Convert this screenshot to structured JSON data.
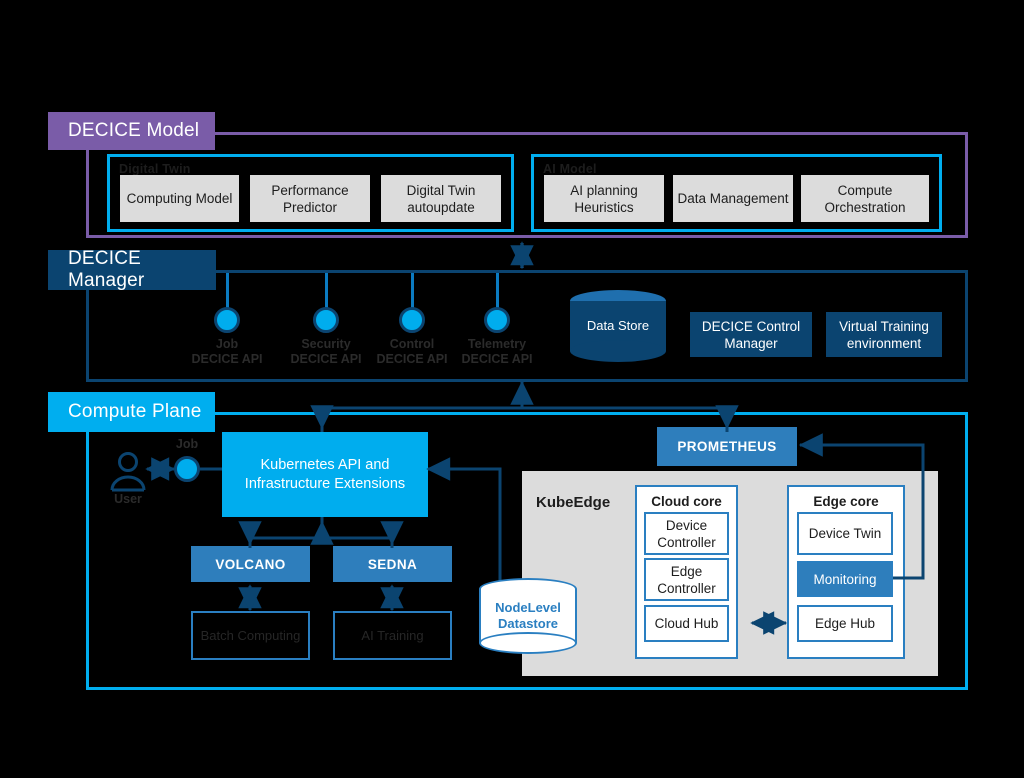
{
  "sections": {
    "model": {
      "title": "DECICE Model",
      "accent": "#7a5ca8",
      "groups": [
        {
          "title": "Digital Twin",
          "items": [
            "Computing Model",
            "Performance Predictor",
            "Digital Twin autoupdate"
          ]
        },
        {
          "title": "AI Model",
          "items": [
            "AI planning Heuristics",
            "Data Management",
            "Compute Orchestration"
          ]
        }
      ]
    },
    "manager": {
      "title": "DECICE Manager",
      "accent": "#0b4470",
      "apis": [
        {
          "name": "Job",
          "api": "DECICE API"
        },
        {
          "name": "Security",
          "api": "DECICE API"
        },
        {
          "name": "Control",
          "api": "DECICE API"
        },
        {
          "name": "Telemetry",
          "api": "DECICE API"
        }
      ],
      "data_store": "Data Store",
      "boxes": [
        "DECICE Control Manager",
        "Virtual Training environment"
      ]
    },
    "compute": {
      "title": "Compute Plane",
      "accent": "#00aeef",
      "user_label": "User",
      "job_label": "Job",
      "kubernetes": "Kubernetes API and Infrastructure Extensions",
      "prometheus": "PROMETHEUS",
      "schedulers": [
        "VOLCANO",
        "SEDNA"
      ],
      "workloads": [
        "Batch Computing",
        "AI Training"
      ],
      "node_datastore": "NodeLevel Datastore",
      "kubeedge": {
        "title": "KubeEdge",
        "cloud_core": {
          "title": "Cloud core",
          "items": [
            "Device Controller",
            "Edge Controller",
            "Cloud Hub"
          ]
        },
        "edge_core": {
          "title": "Edge core",
          "items": [
            "Device Twin",
            "Monitoring",
            "Edge Hub"
          ]
        }
      }
    }
  },
  "colors": {
    "purple": "#7a5ca8",
    "navy": "#0b4470",
    "cyan": "#00aeef",
    "blue": "#2e7ebc",
    "gray": "#dcdcdc"
  }
}
